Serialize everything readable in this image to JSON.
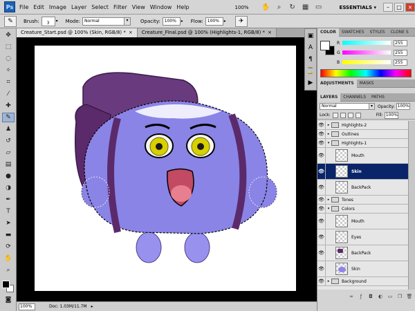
{
  "app": {
    "logo": "Ps"
  },
  "menu": [
    "File",
    "Edit",
    "Image",
    "Layer",
    "Select",
    "Filter",
    "View",
    "Window",
    "Help"
  ],
  "menubar_right": {
    "zoom": "100%",
    "workspace": "ESSENTIALS",
    "workspace_arrow": "▾",
    "icons": [
      "hand-tool-icon",
      "zoom-tool-icon",
      "rotate-view-icon",
      "arrange-documents-icon",
      "screen-mode-icon"
    ]
  },
  "options": {
    "brush_label": "Brush:",
    "brush_size": "3",
    "mode_label": "Mode:",
    "mode_value": "Normal",
    "opacity_label": "Opacity:",
    "opacity_value": "100%",
    "flow_label": "Flow:",
    "flow_value": "100%"
  },
  "tabs": [
    {
      "label": "Creature_Start.psd @ 100% (Skin, RGB/8) *",
      "close": "×"
    },
    {
      "label": "Creature_Final.psd @ 100% (Highlights-1, RGB/8) *",
      "close": "×"
    }
  ],
  "status": {
    "zoom": "100%",
    "doc": "Doc: 1.03M/11.7M",
    "arrow": "▸"
  },
  "color_panel": {
    "tabs": [
      "COLOR",
      "SWATCHES",
      "STYLES",
      "CLONE S"
    ],
    "channels": [
      {
        "label": "R",
        "value": "255"
      },
      {
        "label": "G",
        "value": "255"
      },
      {
        "label": "B",
        "value": "255"
      }
    ]
  },
  "adjust_panel": {
    "tabs": [
      "ADJUSTMENTS",
      "MASKS"
    ]
  },
  "layers_panel": {
    "tabs": [
      "LAYERS",
      "CHANNELS",
      "PATHS"
    ],
    "blend_mode": "Normal",
    "opacity_label": "Opacity:",
    "opacity_value": "100%",
    "lock_label": "Lock:",
    "fill_label": "Fill:",
    "fill_value": "100%",
    "layers": [
      {
        "name": "Highlights-2",
        "kind": "group",
        "expanded": false,
        "indent": 0
      },
      {
        "name": "Outlines",
        "kind": "group",
        "expanded": false,
        "indent": 0
      },
      {
        "name": "Highlights-1",
        "kind": "group",
        "expanded": true,
        "indent": 0
      },
      {
        "name": "Mouth",
        "kind": "layer",
        "thumb": "empty"
      },
      {
        "name": "Skin",
        "kind": "layer",
        "thumb": "empty",
        "selected": true
      },
      {
        "name": "BackPack",
        "kind": "layer",
        "thumb": "empty"
      },
      {
        "name": "Tones",
        "kind": "group",
        "expanded": false,
        "indent": 0
      },
      {
        "name": "Colors",
        "kind": "group",
        "expanded": true,
        "indent": 0
      },
      {
        "name": "Mouth",
        "kind": "layer",
        "thumb": "empty"
      },
      {
        "name": "Eyes",
        "kind": "layer",
        "thumb": "empty"
      },
      {
        "name": "BackPack",
        "kind": "layer",
        "thumb": "pack"
      },
      {
        "name": "Skin",
        "kind": "layer",
        "thumb": "blob"
      },
      {
        "name": "Background",
        "kind": "group",
        "expanded": false,
        "indent": 0
      }
    ],
    "footer_icons": [
      "link-layers-icon",
      "fx-icon",
      "add-mask-icon",
      "adjustment-layer-icon",
      "new-group-icon",
      "new-layer-icon",
      "trash-icon"
    ]
  },
  "colors": {
    "selection": "#0a246a",
    "creature_body": "#8a84e6",
    "backpack": "#5b2a6b",
    "eye_yellow": "#d8d000",
    "tongue": "#e87f90"
  }
}
